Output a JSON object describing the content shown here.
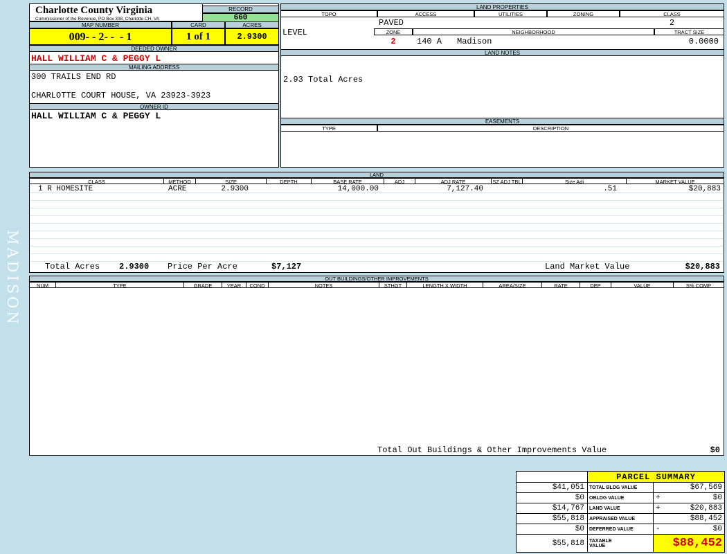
{
  "colors": {
    "page_bg": "#c3dfe9",
    "header_bar": "#b7d0da",
    "record_green": "#97e297",
    "field_yellow": "#ffff00",
    "alert_red": "#cc0000"
  },
  "district": {
    "name": "MADISON"
  },
  "county": {
    "title": "Charlotte County Virginia",
    "subtitle": "Commissioner of the Revenue, PO Box 308, Charlotte CH, VA"
  },
  "record": {
    "label": "RECORD",
    "value": "660"
  },
  "map_number": {
    "label": "MAP NUMBER",
    "value": "009- - 2- -  - 1"
  },
  "card": {
    "label": "CARD",
    "value": "1 of 1"
  },
  "acres": {
    "label": "ACRES",
    "value": "2.9300"
  },
  "deeded_owner": {
    "label": "DEEDED OWNER",
    "value": "HALL WILLIAM C & PEGGY L"
  },
  "mailing_address": {
    "label": "MAILING ADDRESS",
    "line1": "300 TRAILS END RD",
    "line2": "CHARLOTTE COURT HOUSE, VA 23923-3923"
  },
  "owner_id": {
    "label": "OWNER ID",
    "value": "HALL WILLIAM C & PEGGY L"
  },
  "land_properties": {
    "title": "LAND PROPERTIES",
    "columns": [
      "TOPO",
      "ACCESS",
      "UTILITIES",
      "ZONING",
      "CLASS"
    ],
    "topo_value": "LEVEL",
    "access_value": "PAVED",
    "class_value": "2",
    "zone_label": "ZONE",
    "zone_value": "2",
    "zone_code": "140 A",
    "neighborhood_label": "NEIGHBORHOOD",
    "neighborhood_value": "Madison",
    "tract_size_label": "TRACT SIZE",
    "tract_size_value": "0.0000"
  },
  "land_notes": {
    "title": "LAND NOTES",
    "text": "2.93 Total Acres"
  },
  "easements": {
    "title": "EASEMENTS",
    "type_label": "TYPE",
    "description_label": "DESCRIPTION"
  },
  "land_table": {
    "title": "LAND",
    "columns": [
      "CLASS",
      "METHOD",
      "SIZE",
      "DEPTH",
      "BASE RATE",
      "ADJ",
      "ADJ RATE",
      "SZ ADJ TBL",
      "Size Adj",
      "MARKET VALUE"
    ],
    "rows": [
      {
        "class": "1 R HOMESITE",
        "method": "ACRE",
        "size": "2.9300",
        "depth": "",
        "base_rate": "14,000.00",
        "adj": "",
        "adj_rate": "7,127.40",
        "sz_adj_tbl": "",
        "size_adj": ".51",
        "market_value": "$20,883"
      }
    ],
    "totals": {
      "total_acres_label": "Total Acres",
      "total_acres": "2.9300",
      "price_per_acre_label": "Price Per Acre",
      "price_per_acre": "$7,127",
      "land_market_value_label": "Land Market Value",
      "land_market_value": "$20,883"
    }
  },
  "out_buildings": {
    "title": "OUT BUILDINGS/OTHER IMPROVEMENTS",
    "columns": [
      "NUM",
      "TYPE",
      "GRADE",
      "YEAR",
      "COND",
      "NOTES",
      "STHGT",
      "LENGTH X WIDTH",
      "AREA/SIZE",
      "RATE",
      "DEP",
      "VALUE",
      "S% COMP"
    ],
    "total_label": "Total Out Buildings & Other Improvements Value",
    "total_value": "$0"
  },
  "parcel_summary": {
    "title": "PARCEL SUMMARY",
    "rows": [
      {
        "prior": "$41,051",
        "label": "TOTAL BLDG VALUE",
        "op": "",
        "current": "$67,569"
      },
      {
        "prior": "$0",
        "label": "OBLDG VALUE",
        "op": "+",
        "current": "$0"
      },
      {
        "prior": "$14,767",
        "label": "LAND VALUE",
        "op": "+",
        "current": "$20,883"
      },
      {
        "prior": "$55,818",
        "label": "APPRAISED VALUE",
        "op": "",
        "current": "$88,452"
      },
      {
        "prior": "$0",
        "label": "DEFERRED VALUE",
        "op": "-",
        "current": "$0"
      },
      {
        "prior": "$55,818",
        "label": "TAXABLE VALUE",
        "op": "",
        "current": "$88,452"
      }
    ]
  }
}
